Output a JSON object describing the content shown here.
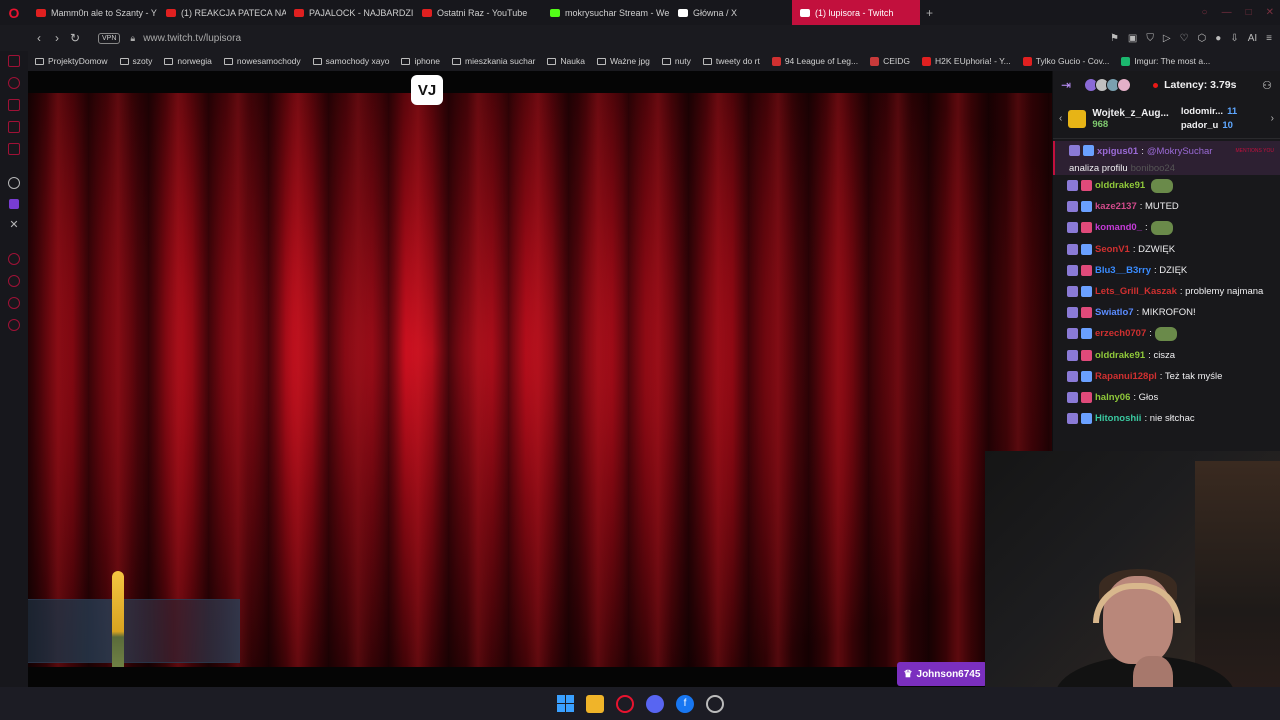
{
  "browser": {
    "tabs": [
      {
        "label": "Mamm0n ale to Szanty - Y",
        "color": "#e02020",
        "active": false
      },
      {
        "label": "(1) REAKCJA PATECA NA",
        "color": "#e02020",
        "active": false
      },
      {
        "label": "PAJALOCK - NAJBARDZI",
        "color": "#e02020",
        "active": false
      },
      {
        "label": "Ostatni Raz - YouTube",
        "color": "#e02020",
        "active": false
      },
      {
        "label": "mokrysuchar Stream - We",
        "color": "#53fc18",
        "active": false
      },
      {
        "label": "Główna / X",
        "color": "#ffffff",
        "active": false
      },
      {
        "label": "(1) lupisora - Twitch",
        "color": "#ffffff",
        "active": true
      }
    ],
    "new_tab_icon": "+",
    "vpn_label": "VPN",
    "url": "www.twitch.tv/lupisora",
    "ai_label": "AI"
  },
  "bookmarks": [
    {
      "label": "ProjektyDomow",
      "type": "folder"
    },
    {
      "label": "szoty",
      "type": "folder"
    },
    {
      "label": "norwegia",
      "type": "folder"
    },
    {
      "label": "nowesamochody",
      "type": "folder"
    },
    {
      "label": "samochody xayo",
      "type": "folder"
    },
    {
      "label": "iphone",
      "type": "folder"
    },
    {
      "label": "mieszkania suchar",
      "type": "folder"
    },
    {
      "label": "Nauka",
      "type": "folder"
    },
    {
      "label": "Ważne jpg",
      "type": "folder"
    },
    {
      "label": "nuty",
      "type": "folder"
    },
    {
      "label": "tweety do rt",
      "type": "folder"
    },
    {
      "label": "94 League of Leg...",
      "type": "site",
      "color": "#d03030"
    },
    {
      "label": "CEIDG",
      "type": "site",
      "color": "#c83a3a"
    },
    {
      "label": "H2K EUphoria! - Y...",
      "type": "site",
      "color": "#e02020"
    },
    {
      "label": "Tylko Gucio - Cov...",
      "type": "site",
      "color": "#e02020"
    },
    {
      "label": "Imgur: The most a...",
      "type": "site",
      "color": "#1bb76e"
    }
  ],
  "stream": {
    "channel_logo_text": "VJ",
    "sub_badge": "Johnson6745"
  },
  "chat": {
    "latency": "Latency: 3.79s",
    "gift": {
      "top_user": "Wojtek_z_Aug...",
      "top_count": "968",
      "side": [
        {
          "user": "lodomir...",
          "count": "11"
        },
        {
          "user": "pador_u",
          "count": "10"
        }
      ]
    },
    "mentions_you": "MENTIONS YOU",
    "messages": [
      {
        "user": "xpigus01",
        "color": "#9a6ad6",
        "mention": "@MokrySuchar",
        "text": "analiza profilu",
        "extra": "boniboo24",
        "highlight": true
      },
      {
        "user": "olddrake91",
        "color": "#8fc83a",
        "text": "",
        "emote": true
      },
      {
        "user": "kaze2137",
        "color": "#d04a8a",
        "text": ": MUTED"
      },
      {
        "user": "komand0_",
        "color": "#c33bd6",
        "text": ":",
        "emote": true
      },
      {
        "user": "SeonV1",
        "color": "#d03030",
        "text": ": DZWIĘK"
      },
      {
        "user": "Blu3__B3rry",
        "color": "#3a8cff",
        "text": ": DZIĘK"
      },
      {
        "user": "Lets_Grill_Kaszak",
        "color": "#d03030",
        "text": ": problemy najmana"
      },
      {
        "user": "Swiatlo7",
        "color": "#5a8cff",
        "text": ": MIKROFON!"
      },
      {
        "user": "erzech0707",
        "color": "#d03030",
        "text": ":",
        "emote": true
      },
      {
        "user": "olddrake91",
        "color": "#8fc83a",
        "text": ": cisza"
      },
      {
        "user": "Rapanui128pl",
        "color": "#d03030",
        "text": ": Też tak myśle"
      },
      {
        "user": "halny06",
        "color": "#8fc83a",
        "text": ": Głos"
      },
      {
        "user": "Hitonoshii",
        "color": "#3ac8a0",
        "text": ": nie słtchac"
      }
    ]
  },
  "colors": {
    "accent": "#c2103d",
    "twitch_purple": "#9146ff",
    "curtain_red": "#d31020"
  }
}
